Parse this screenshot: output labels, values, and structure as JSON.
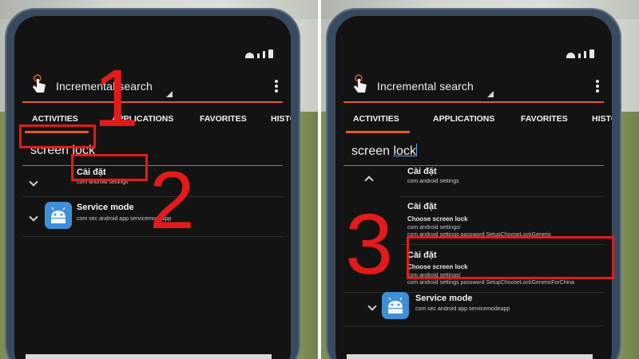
{
  "app": {
    "title": "Incremental search",
    "tabs": [
      "ACTIVITIES",
      "APPLICATIONS",
      "FAVORITES",
      "HISTO"
    ]
  },
  "search": {
    "word1": "screen",
    "word2": "lock"
  },
  "left": {
    "results": [
      {
        "title": "Cài đặt",
        "package": "com android settings"
      },
      {
        "title": "Service mode",
        "package": "com sec android app servicemodeapp"
      }
    ]
  },
  "right": {
    "group_title": "Cài đặt",
    "group_package": "com android settings",
    "activity1": {
      "title": "Cài đặt",
      "subtitle": "Choose screen lock",
      "line1": "com android settings/",
      "line2": "com android settings password SetupChooseLockGeneric"
    },
    "activity2": {
      "title": "Cài đặt",
      "subtitle": "Choose screen lock",
      "line1": "com android settings/",
      "line2": "com android settings password SetupChooseLockGenericForChina"
    },
    "service": {
      "title": "Service mode",
      "package": "com sec android app servicemodeapp"
    }
  },
  "annotations": {
    "step1": "1",
    "step2": "2",
    "step3": "3"
  },
  "colors": {
    "accent": "#e3582b",
    "highlight": "#e31a1a",
    "icon_bg": "#3f8fd6"
  },
  "icons": [
    "touch-hand-icon",
    "overflow-menu-icon",
    "expand-chevron-icon",
    "collapse-chevron-icon",
    "android-icon",
    "wifi-icon",
    "signal-icon",
    "battery-icon"
  ]
}
